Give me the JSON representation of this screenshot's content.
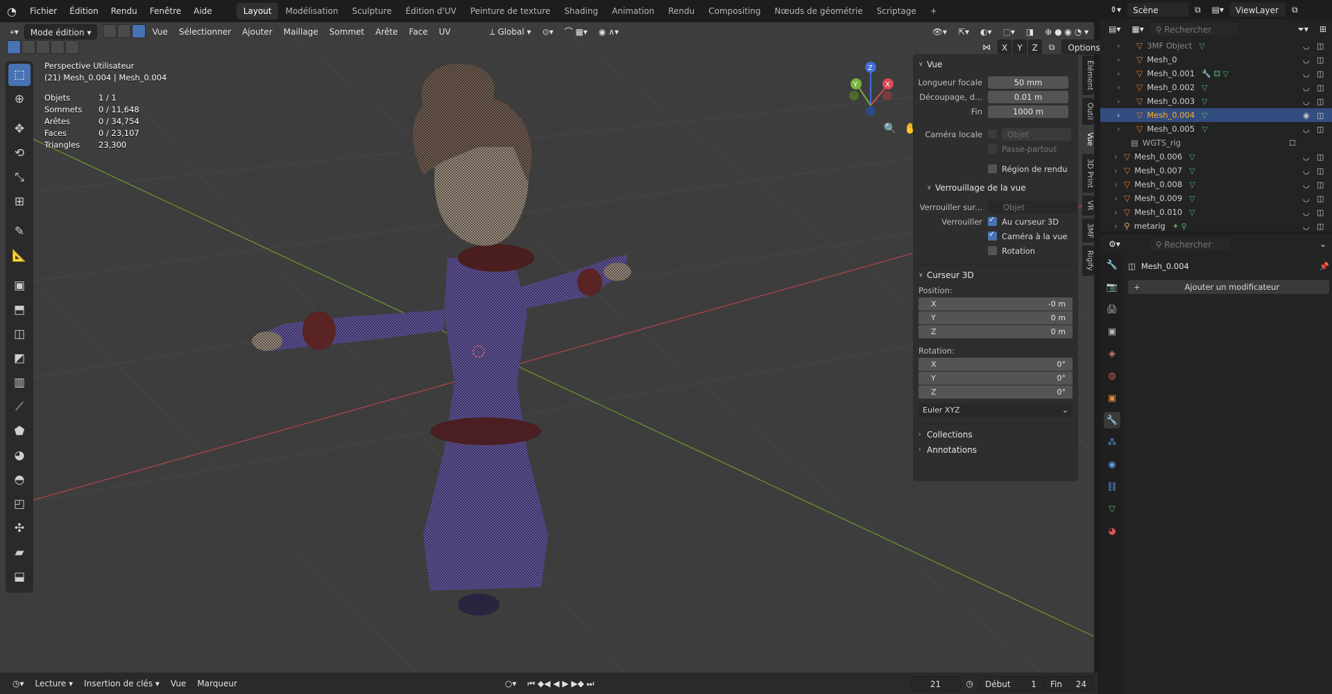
{
  "menu": {
    "items": [
      "Fichier",
      "Édition",
      "Rendu",
      "Fenêtre",
      "Aide"
    ],
    "workspaces": [
      "Layout",
      "Modélisation",
      "Sculpture",
      "Édition d'UV",
      "Peinture de texture",
      "Shading",
      "Animation",
      "Rendu",
      "Compositing",
      "Nœuds de géométrie",
      "Scriptage"
    ],
    "active_workspace": "Layout",
    "add_tab": "+",
    "scene": "Scène",
    "view_layer": "ViewLayer"
  },
  "viewport_header": {
    "mode": "Mode édition",
    "menus": [
      "Vue",
      "Sélectionner",
      "Ajouter",
      "Maillage",
      "Sommet",
      "Arête",
      "Face",
      "UV"
    ],
    "transform": "Global",
    "options": "Options",
    "axes": [
      "X",
      "Y",
      "Z"
    ]
  },
  "overlay": {
    "view_name": "Perspective Utilisateur",
    "object_info": "(21) Mesh_0.004 | Mesh_0.004",
    "stats": [
      {
        "label": "Objets",
        "value": "1 / 1"
      },
      {
        "label": "Sommets",
        "value": "0 / 11,648"
      },
      {
        "label": "Arêtes",
        "value": "0 / 34,754"
      },
      {
        "label": "Faces",
        "value": "0 / 23,107"
      },
      {
        "label": "Triangles",
        "value": "23,300"
      }
    ]
  },
  "gizmo": {
    "z": "Z",
    "y": "Y",
    "x": "X"
  },
  "npanel": {
    "view_header": "Vue",
    "focal_label": "Longueur focale",
    "focal_value": "50 mm",
    "clip_label": "Découpage, d...",
    "clip_start": "0.01 m",
    "end_label": "Fin",
    "clip_end": "1000 m",
    "local_cam_label": "Caméra locale",
    "local_cam_placeholder": "Objet",
    "passepartout": "Passe-partout",
    "render_region": "Région de rendu",
    "lock_header": "Verrouillage de la vue",
    "lock_on_label": "Verrouiller sur...",
    "lock_on_placeholder": "Objet",
    "lock_label": "Verrouiller",
    "lock_cursor": "Au curseur 3D",
    "lock_camera": "Caméra à la vue",
    "lock_rotation": "Rotation",
    "cursor_header": "Curseur 3D",
    "position_label": "Position:",
    "position": [
      {
        "axis": "X",
        "value": "-0 m"
      },
      {
        "axis": "Y",
        "value": "0 m"
      },
      {
        "axis": "Z",
        "value": "0 m"
      }
    ],
    "rotation_label": "Rotation:",
    "rotation": [
      {
        "axis": "X",
        "value": "0°"
      },
      {
        "axis": "Y",
        "value": "0°"
      },
      {
        "axis": "Z",
        "value": "0°"
      }
    ],
    "rotation_mode": "Euler XYZ",
    "collections": "Collections",
    "annotations": "Annotations"
  },
  "side_tabs": [
    "Élément",
    "Outil",
    "Vue",
    "3D Print",
    "VR",
    "3MF",
    "Rigify"
  ],
  "active_side_tab": "Vue",
  "timeline": {
    "menus": [
      "Lecture",
      "Insertion de clés",
      "Vue",
      "Marqueur"
    ],
    "current_frame": "21",
    "start_label": "Début",
    "start": "1",
    "end_label": "Fin",
    "end": "24"
  },
  "outliner": {
    "search_placeholder": "Rechercher",
    "items": [
      {
        "name": "3MF Object",
        "indent": 1
      },
      {
        "name": "Mesh_0",
        "indent": 1
      },
      {
        "name": "Mesh_0.001",
        "indent": 1
      },
      {
        "name": "Mesh_0.002",
        "indent": 1
      },
      {
        "name": "Mesh_0.003",
        "indent": 1
      },
      {
        "name": "Mesh_0.004",
        "indent": 1,
        "selected": true
      },
      {
        "name": "Mesh_0.005",
        "indent": 1
      },
      {
        "name": "WGTS_rig",
        "indent": 0
      },
      {
        "name": "Mesh_0.006",
        "indent": 0
      },
      {
        "name": "Mesh_0.007",
        "indent": 0
      },
      {
        "name": "Mesh_0.008",
        "indent": 0
      },
      {
        "name": "Mesh_0.009",
        "indent": 0
      },
      {
        "name": "Mesh_0.010",
        "indent": 0
      },
      {
        "name": "metarig",
        "indent": 0
      }
    ]
  },
  "properties": {
    "search_placeholder": "Rechercher",
    "object_name": "Mesh_0.004",
    "add_modifier": "Ajouter un modificateur"
  },
  "colors": {
    "accent": "#4772b3",
    "selected_text": "#ffaf29",
    "mesh_purple": "#7a68b8",
    "x_axis": "#b8444c",
    "y_axis": "#6f9a2e"
  }
}
